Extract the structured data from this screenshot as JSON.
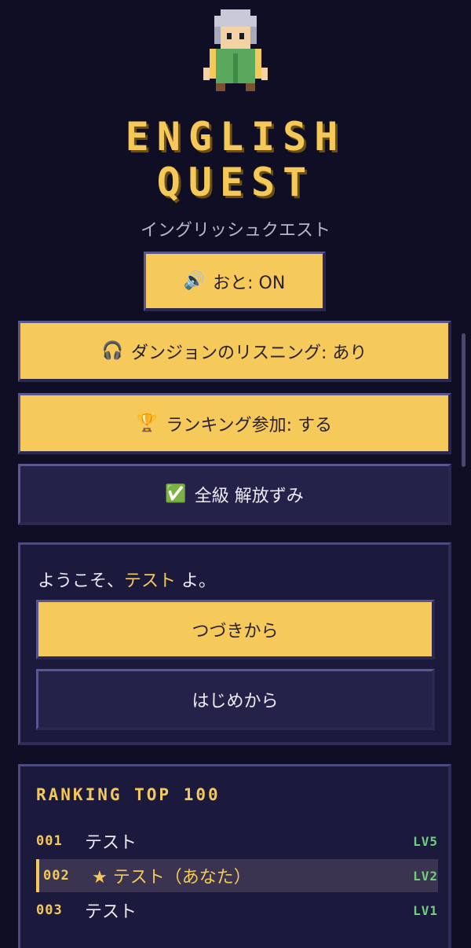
{
  "title": {
    "line1": "ENGLISH",
    "line2": "QUEST",
    "subtitle": "イングリッシュクエスト"
  },
  "settings": {
    "sound": {
      "icon": "🔊",
      "label": "おと: ON"
    },
    "listening": {
      "icon": "🎧",
      "label": "ダンジョンのリスニング: あり"
    },
    "ranking": {
      "icon": "🏆",
      "label": "ランキング参加: する"
    },
    "unlock": {
      "icon": "✅",
      "label": "全級 解放ずみ"
    }
  },
  "welcome": {
    "prefix": "ようこそ、",
    "name": "テスト",
    "suffix": " よ。",
    "continue_label": "つづきから",
    "new_game_label": "はじめから"
  },
  "ranking": {
    "heading": "RANKING TOP 100",
    "rows": [
      {
        "rank": "001",
        "name": "テスト",
        "level": "LV5"
      },
      {
        "rank": "002",
        "name": "★ テスト（あなた）",
        "level": "LV2"
      },
      {
        "rank": "003",
        "name": "テスト",
        "level": "LV1"
      }
    ]
  },
  "colors": {
    "accent": "#f4c95a",
    "background": "#0f0e24",
    "panel": "#1c1a3c",
    "level": "#6fd17a"
  }
}
